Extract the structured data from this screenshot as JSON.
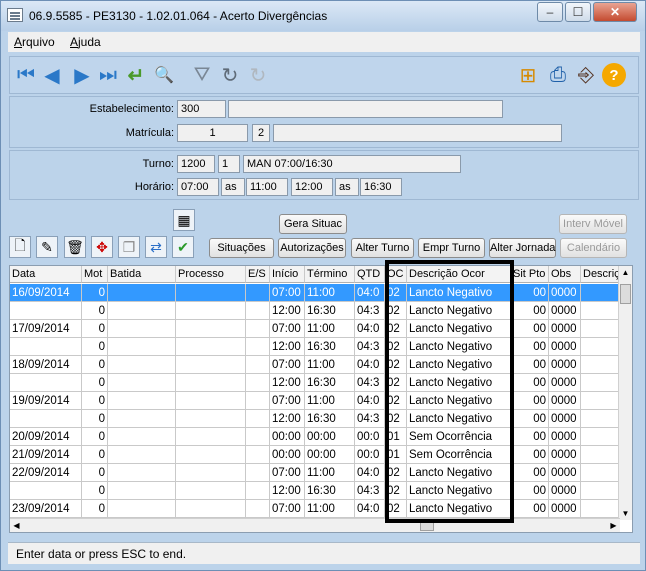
{
  "window": {
    "title": "06.9.5585 - PE3130 - 1.02.01.064 - Acerto Divergências",
    "min_label": "‒",
    "max_label": "☐",
    "close_label": "✕"
  },
  "menu": {
    "arquivo_first": "A",
    "arquivo_rest": "rquivo",
    "ajuda_first": "A",
    "ajuda_rest": "juda"
  },
  "toolbar": {
    "icons": [
      "first-icon",
      "previous-icon",
      "next-icon",
      "last-icon",
      "return-icon",
      "zoom-icon",
      "filter-icon",
      "refresh-icon",
      "redo-icon",
      "tree-icon",
      "print-icon",
      "exit-icon",
      "help-icon"
    ],
    "glyphs": {
      "first": "⏮",
      "previous": "◀",
      "next": "▶",
      "last": "⏭",
      "return": "↵",
      "zoom": "🔍",
      "filter": "⛛",
      "refresh": "↻",
      "redo": "↻",
      "tree": "⊞",
      "print": "⎙",
      "exit": "⎆",
      "help": "?"
    }
  },
  "form": {
    "estabelecimento_label": "Estabelecimento:",
    "estabelecimento_code": "300",
    "estabelecimento_desc": "",
    "matricula_label": "Matrícula:",
    "matricula_num": "1",
    "matricula_dv": "2",
    "matricula_name": "",
    "turno_label": "Turno:",
    "turno_code": "1200",
    "turno_seq": "1",
    "turno_desc": "MAN 07:00/16:30",
    "horario_label": "Horário:",
    "h1": "07:00",
    "as1": "as",
    "h2": "11:00",
    "h3": "12:00",
    "as2": "as",
    "h4": "16:30"
  },
  "buttons": {
    "gera_situac": "Gera Situac",
    "interv_movel": "Interv Móvel",
    "situacoes": "Situações",
    "autorizacoes": "Autorizações",
    "alter_turno": "Alter Turno",
    "empr_turno": "Empr Turno",
    "alter_jornada": "Alter Jornada",
    "calendario": "Calendário"
  },
  "grid": {
    "headers": [
      "Data",
      "Mot",
      "Batida",
      "Processo",
      "E/S",
      "Início",
      "Término",
      "QTD",
      "OC",
      "Descrição Ocor",
      "Sit Pto",
      "Obs",
      "Descriçã"
    ],
    "rows": [
      [
        "16/09/2014",
        "0",
        "",
        "",
        "",
        "07:00",
        "11:00",
        "04:0",
        "02",
        "Lancto Negativo",
        "00",
        "0000",
        ""
      ],
      [
        "",
        "0",
        "",
        "",
        "",
        "12:00",
        "16:30",
        "04:3",
        "02",
        "Lancto Negativo",
        "00",
        "0000",
        ""
      ],
      [
        "17/09/2014",
        "0",
        "",
        "",
        "",
        "07:00",
        "11:00",
        "04:0",
        "02",
        "Lancto Negativo",
        "00",
        "0000",
        ""
      ],
      [
        "",
        "0",
        "",
        "",
        "",
        "12:00",
        "16:30",
        "04:3",
        "02",
        "Lancto Negativo",
        "00",
        "0000",
        ""
      ],
      [
        "18/09/2014",
        "0",
        "",
        "",
        "",
        "07:00",
        "11:00",
        "04:0",
        "02",
        "Lancto Negativo",
        "00",
        "0000",
        ""
      ],
      [
        "",
        "0",
        "",
        "",
        "",
        "12:00",
        "16:30",
        "04:3",
        "02",
        "Lancto Negativo",
        "00",
        "0000",
        ""
      ],
      [
        "19/09/2014",
        "0",
        "",
        "",
        "",
        "07:00",
        "11:00",
        "04:0",
        "02",
        "Lancto Negativo",
        "00",
        "0000",
        ""
      ],
      [
        "",
        "0",
        "",
        "",
        "",
        "12:00",
        "16:30",
        "04:3",
        "02",
        "Lancto Negativo",
        "00",
        "0000",
        ""
      ],
      [
        "20/09/2014",
        "0",
        "",
        "",
        "",
        "00:00",
        "00:00",
        "00:0",
        "01",
        "Sem Ocorrência",
        "00",
        "0000",
        ""
      ],
      [
        "21/09/2014",
        "0",
        "",
        "",
        "",
        "00:00",
        "00:00",
        "00:0",
        "01",
        "Sem Ocorrência",
        "00",
        "0000",
        ""
      ],
      [
        "22/09/2014",
        "0",
        "",
        "",
        "",
        "07:00",
        "11:00",
        "04:0",
        "02",
        "Lancto Negativo",
        "00",
        "0000",
        ""
      ],
      [
        "",
        "0",
        "",
        "",
        "",
        "12:00",
        "16:30",
        "04:3",
        "02",
        "Lancto Negativo",
        "00",
        "0000",
        ""
      ],
      [
        "23/09/2014",
        "0",
        "",
        "",
        "",
        "07:00",
        "11:00",
        "04:0",
        "02",
        "Lancto Negativo",
        "00",
        "0000",
        ""
      ]
    ],
    "selected_row": 0,
    "scroll_up": "▲",
    "scroll_down": "▼",
    "scroll_left": "◀",
    "scroll_right": "▶"
  },
  "status": {
    "text": "Enter data or press ESC to end."
  }
}
